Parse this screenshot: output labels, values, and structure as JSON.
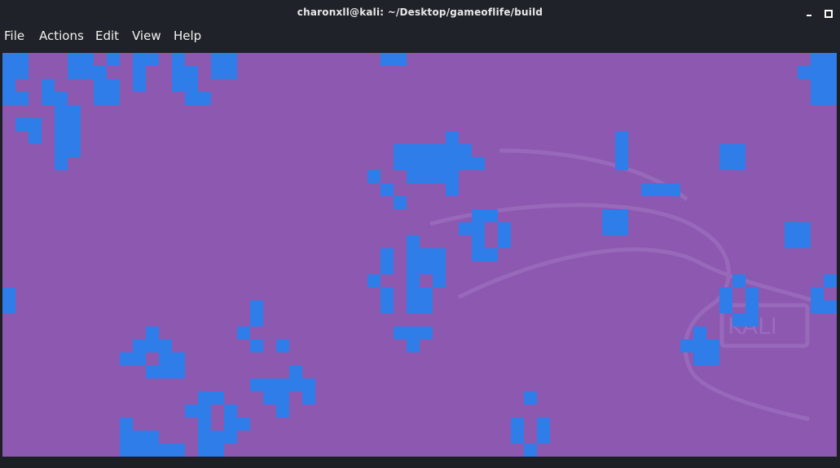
{
  "window": {
    "title": "charonxll@kali: ~/Desktop/gameoflife/build",
    "minimize_icon": "minimize-icon",
    "maximize_icon": "maximize-icon"
  },
  "menu": {
    "items": [
      "File",
      "Actions",
      "Edit",
      "View",
      "Help"
    ]
  },
  "canvas": {
    "background": "#8c58b0",
    "cell_color": "#2f7de8",
    "watermark_color": "#a379c5",
    "watermark_text": "KALI",
    "cells": [
      [
        0,
        0
      ],
      [
        1,
        0
      ],
      [
        5,
        0
      ],
      [
        6,
        0
      ],
      [
        8,
        0
      ],
      [
        10,
        0
      ],
      [
        11,
        0
      ],
      [
        13,
        0
      ],
      [
        16,
        0
      ],
      [
        17,
        0
      ],
      [
        29,
        0
      ],
      [
        30,
        0
      ],
      [
        62,
        0
      ],
      [
        63,
        0
      ],
      [
        0,
        1
      ],
      [
        1,
        1
      ],
      [
        5,
        1
      ],
      [
        6,
        1
      ],
      [
        7,
        1
      ],
      [
        10,
        1
      ],
      [
        13,
        1
      ],
      [
        14,
        1
      ],
      [
        16,
        1
      ],
      [
        17,
        1
      ],
      [
        61,
        1
      ],
      [
        62,
        1
      ],
      [
        63,
        1
      ],
      [
        0,
        2
      ],
      [
        3,
        2
      ],
      [
        7,
        2
      ],
      [
        8,
        2
      ],
      [
        10,
        2
      ],
      [
        13,
        2
      ],
      [
        14,
        2
      ],
      [
        62,
        2
      ],
      [
        63,
        2
      ],
      [
        0,
        3
      ],
      [
        1,
        3
      ],
      [
        3,
        3
      ],
      [
        4,
        3
      ],
      [
        7,
        3
      ],
      [
        8,
        3
      ],
      [
        14,
        3
      ],
      [
        15,
        3
      ],
      [
        62,
        3
      ],
      [
        63,
        3
      ],
      [
        4,
        4
      ],
      [
        5,
        4
      ],
      [
        1,
        5
      ],
      [
        2,
        5
      ],
      [
        4,
        5
      ],
      [
        5,
        5
      ],
      [
        2,
        6
      ],
      [
        4,
        6
      ],
      [
        5,
        6
      ],
      [
        34,
        6
      ],
      [
        47,
        6
      ],
      [
        4,
        7
      ],
      [
        5,
        7
      ],
      [
        30,
        7
      ],
      [
        31,
        7
      ],
      [
        32,
        7
      ],
      [
        33,
        7
      ],
      [
        34,
        7
      ],
      [
        35,
        7
      ],
      [
        47,
        7
      ],
      [
        55,
        7
      ],
      [
        56,
        7
      ],
      [
        4,
        8
      ],
      [
        30,
        8
      ],
      [
        31,
        8
      ],
      [
        32,
        8
      ],
      [
        33,
        8
      ],
      [
        34,
        8
      ],
      [
        35,
        8
      ],
      [
        36,
        8
      ],
      [
        47,
        8
      ],
      [
        55,
        8
      ],
      [
        56,
        8
      ],
      [
        28,
        9
      ],
      [
        31,
        9
      ],
      [
        32,
        9
      ],
      [
        33,
        9
      ],
      [
        34,
        9
      ],
      [
        29,
        10
      ],
      [
        34,
        10
      ],
      [
        49,
        10
      ],
      [
        50,
        10
      ],
      [
        51,
        10
      ],
      [
        30,
        11
      ],
      [
        36,
        12
      ],
      [
        37,
        12
      ],
      [
        46,
        12
      ],
      [
        47,
        12
      ],
      [
        35,
        13
      ],
      [
        36,
        13
      ],
      [
        38,
        13
      ],
      [
        46,
        13
      ],
      [
        47,
        13
      ],
      [
        60,
        13
      ],
      [
        61,
        13
      ],
      [
        31,
        14
      ],
      [
        36,
        14
      ],
      [
        38,
        14
      ],
      [
        60,
        14
      ],
      [
        61,
        14
      ],
      [
        29,
        15
      ],
      [
        31,
        15
      ],
      [
        32,
        15
      ],
      [
        33,
        15
      ],
      [
        36,
        15
      ],
      [
        37,
        15
      ],
      [
        29,
        16
      ],
      [
        31,
        16
      ],
      [
        32,
        16
      ],
      [
        33,
        16
      ],
      [
        28,
        17
      ],
      [
        29,
        16
      ],
      [
        31,
        17
      ],
      [
        33,
        17
      ],
      [
        56,
        17
      ],
      [
        63,
        17
      ],
      [
        0,
        18
      ],
      [
        29,
        18
      ],
      [
        31,
        18
      ],
      [
        32,
        18
      ],
      [
        55,
        18
      ],
      [
        57,
        18
      ],
      [
        62,
        18
      ],
      [
        0,
        19
      ],
      [
        32,
        19
      ],
      [
        55,
        19
      ],
      [
        57,
        19
      ],
      [
        62,
        19
      ],
      [
        63,
        19
      ],
      [
        19,
        19
      ],
      [
        29,
        19
      ],
      [
        31,
        19
      ],
      [
        32,
        19
      ],
      [
        19,
        20
      ],
      [
        56,
        20
      ],
      [
        57,
        20
      ],
      [
        18,
        21
      ],
      [
        30,
        21
      ],
      [
        31,
        21
      ],
      [
        32,
        21
      ],
      [
        11,
        21
      ],
      [
        31,
        22
      ],
      [
        53,
        21
      ],
      [
        10,
        22
      ],
      [
        11,
        22
      ],
      [
        12,
        22
      ],
      [
        19,
        22
      ],
      [
        21,
        22
      ],
      [
        52,
        22
      ],
      [
        53,
        22
      ],
      [
        54,
        22
      ],
      [
        9,
        23
      ],
      [
        10,
        23
      ],
      [
        12,
        23
      ],
      [
        13,
        23
      ],
      [
        53,
        23
      ],
      [
        54,
        23
      ],
      [
        11,
        24
      ],
      [
        12,
        24
      ],
      [
        13,
        24
      ],
      [
        22,
        24
      ],
      [
        19,
        25
      ],
      [
        20,
        25
      ],
      [
        21,
        25
      ],
      [
        22,
        25
      ],
      [
        23,
        25
      ],
      [
        20,
        26
      ],
      [
        21,
        26
      ],
      [
        23,
        26
      ],
      [
        15,
        26
      ],
      [
        16,
        26
      ],
      [
        21,
        27
      ],
      [
        14,
        27
      ],
      [
        15,
        27
      ],
      [
        17,
        27
      ],
      [
        40,
        26
      ],
      [
        9,
        28
      ],
      [
        15,
        28
      ],
      [
        17,
        28
      ],
      [
        18,
        28
      ],
      [
        39,
        28
      ],
      [
        41,
        28
      ],
      [
        9,
        29
      ],
      [
        10,
        29
      ],
      [
        11,
        29
      ],
      [
        15,
        29
      ],
      [
        16,
        29
      ],
      [
        17,
        29
      ],
      [
        39,
        29
      ],
      [
        41,
        29
      ],
      [
        9,
        30
      ],
      [
        10,
        30
      ],
      [
        11,
        30
      ],
      [
        12,
        30
      ],
      [
        13,
        30
      ],
      [
        15,
        30
      ],
      [
        16,
        30
      ],
      [
        40,
        30
      ],
      [
        9,
        31
      ],
      [
        11,
        31
      ],
      [
        13,
        31
      ],
      [
        15,
        31
      ],
      [
        16,
        31
      ]
    ]
  }
}
